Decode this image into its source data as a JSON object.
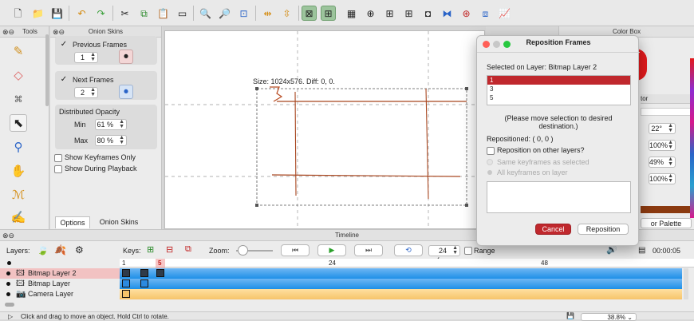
{
  "panels": {
    "tools_title": "Tools",
    "onion_title": "Onion Skins",
    "color_box_title": "Color Box",
    "timeline_title": "Timeline"
  },
  "onion": {
    "previous_frames_label": "Previous Frames",
    "previous_frames_value": "1",
    "next_frames_label": "Next Frames",
    "next_frames_value": "2",
    "distributed_opacity_label": "Distributed Opacity",
    "min_label": "Min",
    "min_value": "61 %",
    "max_label": "Max",
    "max_value": "80 %",
    "show_keyframes_only": "Show Keyframes Only",
    "show_during_playback": "Show During Playback",
    "tabs": [
      "Options",
      "Onion Skins"
    ]
  },
  "canvas": {
    "info_text": "Size: 1024x576. Diff: 0, 0."
  },
  "right_panel": {
    "tab_fragment": "tor",
    "angle_value": "22°",
    "percent_1": "100%",
    "percent_2": "49%",
    "percent_3": "100%",
    "palette_fragment": "or Palette",
    "color_swatch": "#e31a1c",
    "bar_color": "#8b3a10"
  },
  "dialog": {
    "title": "Reposition Frames",
    "selected_on_layer": "Selected on Layer: Bitmap Layer 2",
    "frames": [
      "1",
      "3",
      "5"
    ],
    "instruction_line1": "(Please move selection to desired",
    "instruction_line2": "destination.)",
    "repositioned": "Repositioned: ( 0, 0 )",
    "reposition_other_layers": "Reposition on other layers?",
    "same_keyframes": "Same keyframes as selected",
    "all_keyframes": "All keyframes on layer",
    "cancel_label": "Cancel",
    "reposition_label": "Reposition",
    "accent_color": "#c0282d"
  },
  "timeline": {
    "layers_label": "Layers:",
    "keys_label": "Keys:",
    "zoom_label": "Zoom:",
    "fps_value": "24 fps",
    "range_label": "Range",
    "time_value": "00:00:05",
    "ruler_marks": [
      "1",
      "5",
      "24",
      "48"
    ],
    "current_frame": "5",
    "layers": [
      {
        "name": "Bitmap Layer 2",
        "selected": true
      },
      {
        "name": "Bitmap Layer",
        "selected": false
      },
      {
        "name": "Camera Layer",
        "selected": false
      }
    ],
    "bitmap_color": "#1e8fe8",
    "camera_color": "#f6c46a"
  },
  "status": {
    "message": "Click and drag to move an object. Hold Ctrl to rotate.",
    "zoom_value": "38.8%"
  },
  "icons": {
    "toolbar": [
      "new-file-icon",
      "open-folder-icon",
      "save-icon",
      "undo-icon",
      "redo-icon",
      "cut-icon",
      "copy-icon",
      "paste-icon",
      "clear-icon",
      "zoom-in-icon",
      "zoom-out-icon",
      "zoom-fit-icon",
      "flip-horizontal-icon",
      "flip-vertical-icon",
      "grid-toggle-icon",
      "thirds-grid-icon",
      "center-overlay-icon",
      "grid-4-icon",
      "grid-3-icon",
      "safe-area-icon",
      "perspective-1-icon",
      "perspective-2-icon",
      "perspective-3-icon",
      "graph-icon"
    ],
    "tools": [
      "pencil-icon",
      "eraser-icon",
      "polyline-icon",
      "select-icon",
      "eyedropper-icon",
      "hand-icon",
      "bucket-icon",
      "smudge-icon"
    ]
  }
}
